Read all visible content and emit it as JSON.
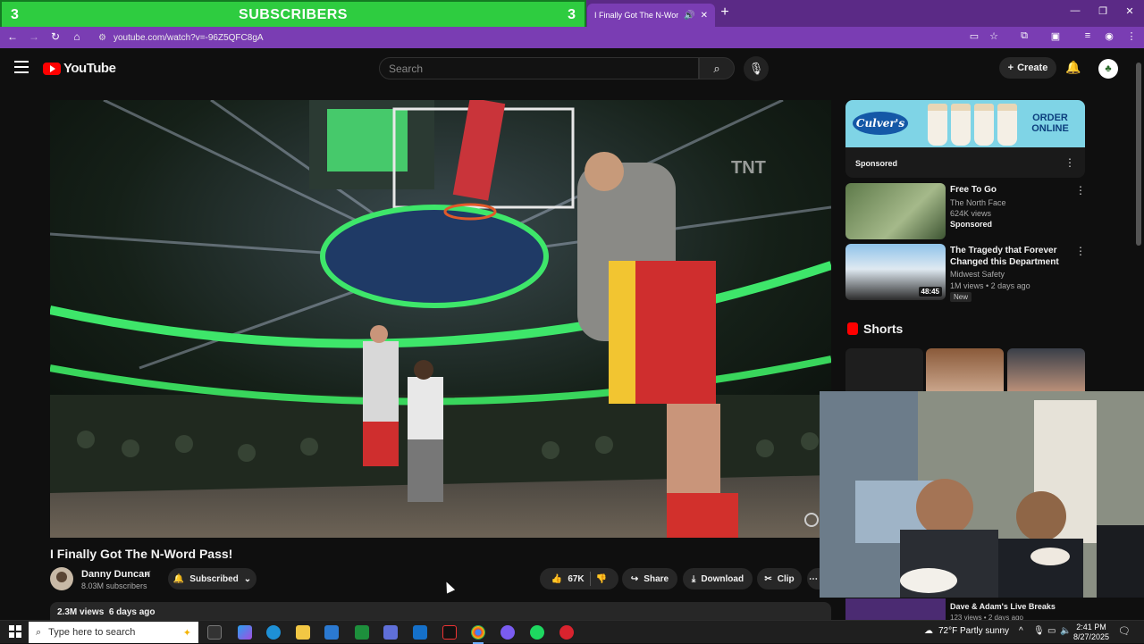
{
  "overlay": {
    "left_count": "3",
    "label": "SUBSCRIBERS",
    "right_count": "3"
  },
  "browser": {
    "tab_title": "I Finally Got The N-Word Pa",
    "url": "youtube.com/watch?v=-96Z5QFC8gA"
  },
  "youtube": {
    "logo_text": "YouTube",
    "search_placeholder": "Search",
    "create_label": "Create"
  },
  "video": {
    "title": "I Finally Got The N-Word Pass!",
    "channel": "Danny Duncan",
    "subscribers": "8.03M subscribers",
    "subscribed_label": "Subscribed",
    "likes": "67K",
    "share_label": "Share",
    "download_label": "Download",
    "clip_label": "Clip",
    "views": "2.3M views",
    "age": "6 days ago",
    "watermark": "TNT"
  },
  "sidebar": {
    "ad": {
      "brand": "Culver's",
      "cta_line1": "ORDER",
      "cta_line2": "ONLINE",
      "sponsored": "Sponsored"
    },
    "recommendations": [
      {
        "title": "Free To Go",
        "channel": "The North Face",
        "views": "624K views",
        "badge": "Sponsored"
      },
      {
        "title": "The Tragedy that Forever Changed this Department",
        "channel": "Midwest Safety",
        "meta": "1M views • 2 days ago",
        "duration": "48:45",
        "badge": "New"
      }
    ],
    "shorts_label": "Shorts",
    "below_cam": {
      "title": "Dave & Adam's Live Breaks",
      "meta": "123 views • 2 days ago"
    }
  },
  "taskbar": {
    "search_placeholder": "Type here to search",
    "weather": "72°F  Partly sunny",
    "time": "2:41 PM",
    "date": "8/27/2025"
  }
}
